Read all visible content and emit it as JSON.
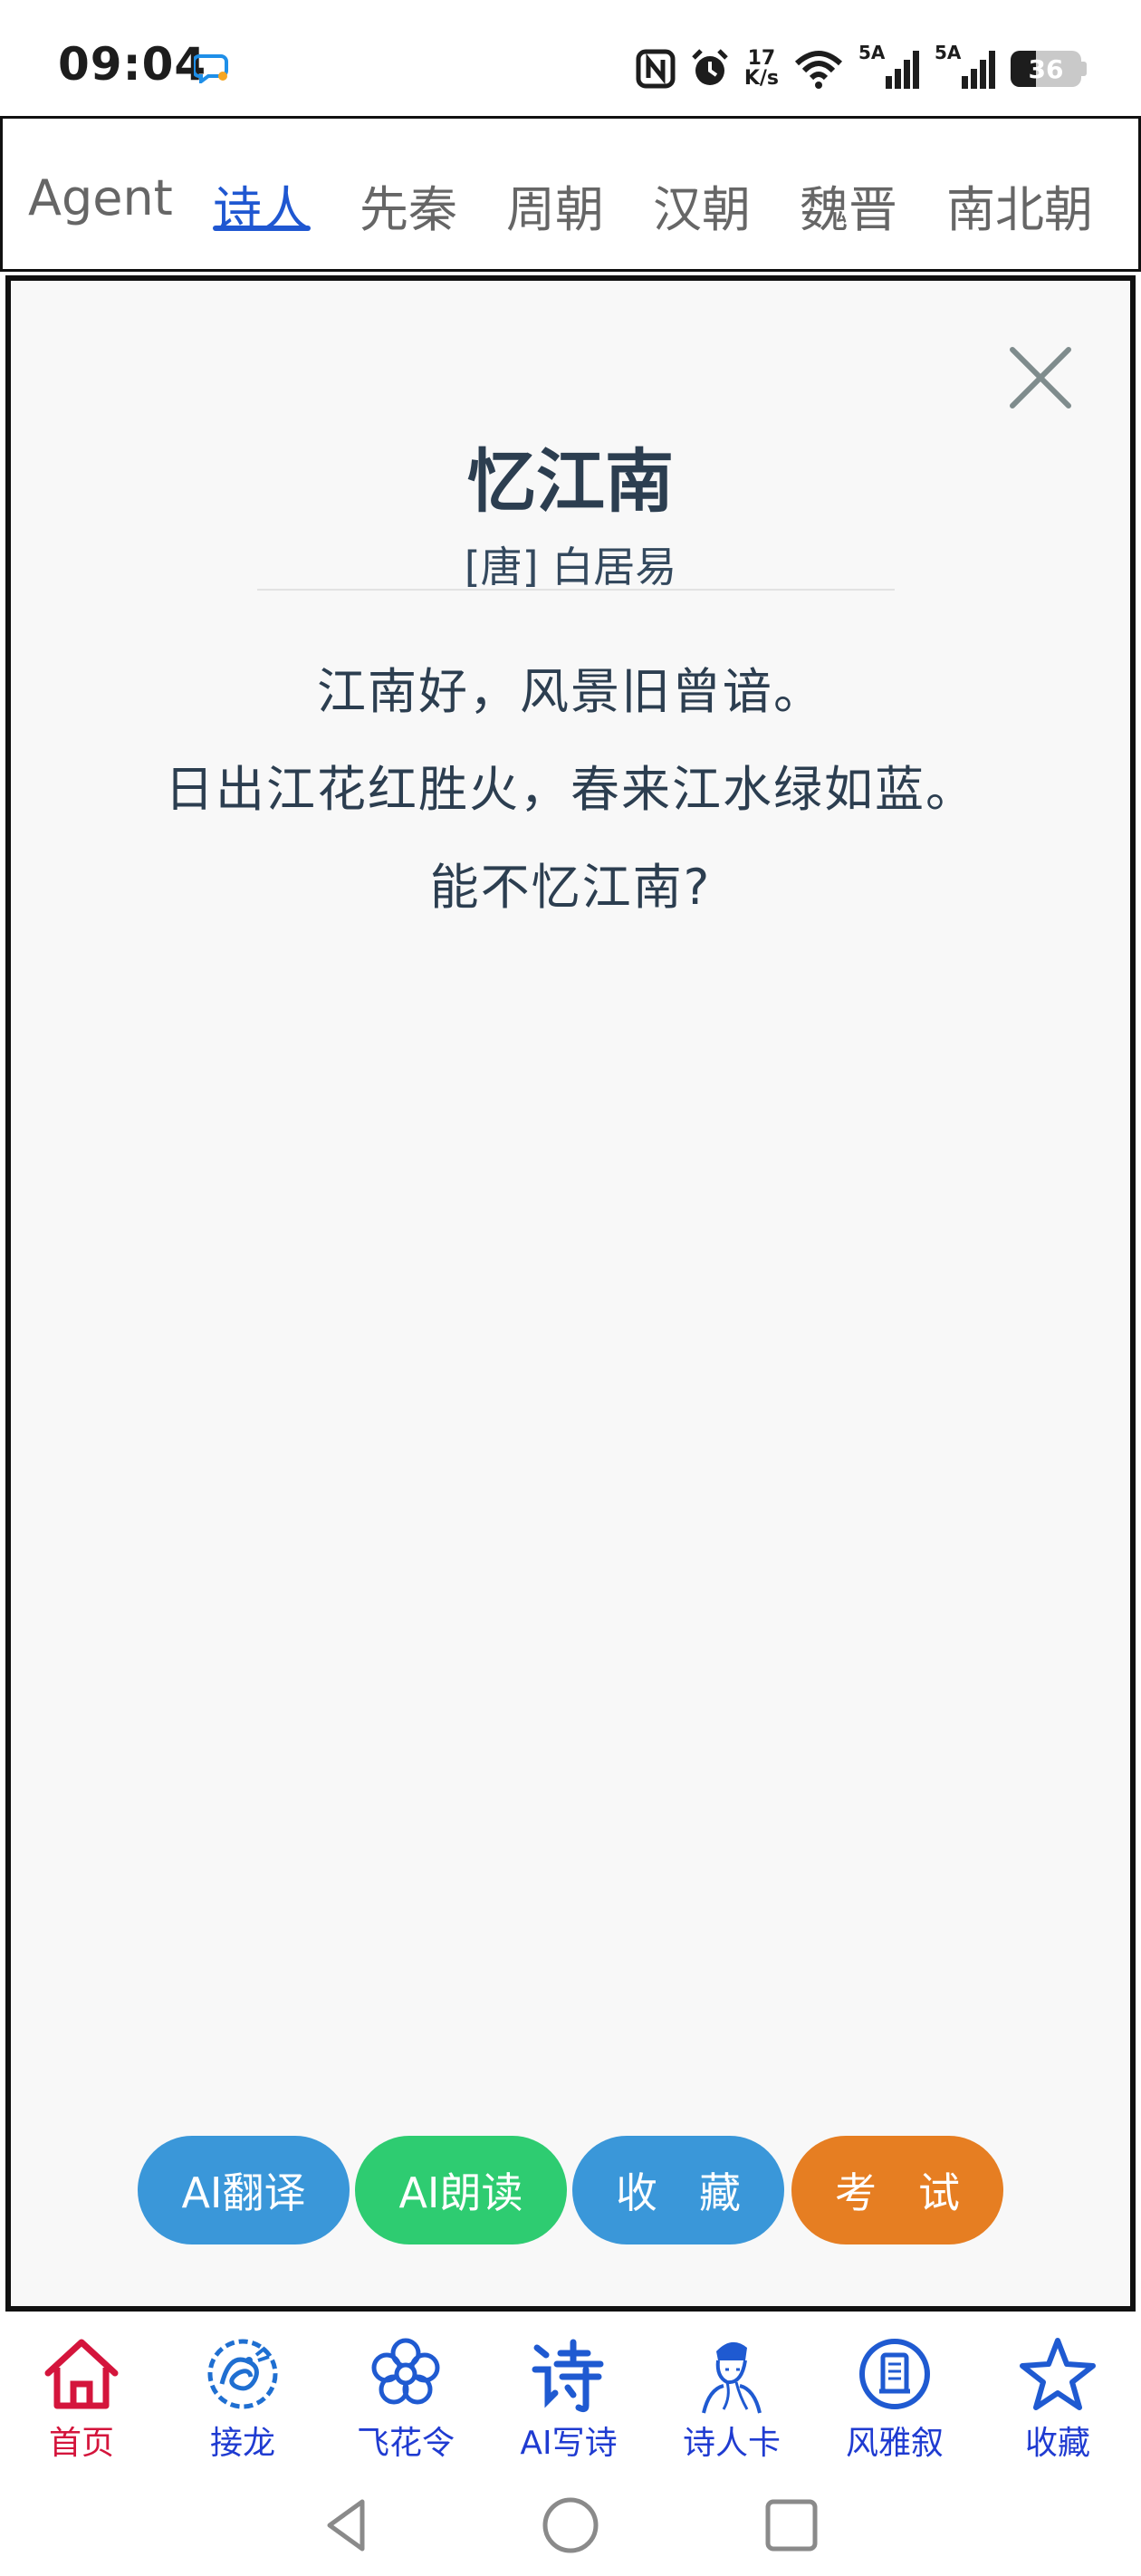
{
  "status_bar": {
    "time": "09:04",
    "net_speed_top": "17",
    "net_speed_bottom": "K/s",
    "sim1_label": "5A",
    "sim2_label": "5A",
    "battery": "36",
    "battery_level": 0.36
  },
  "tabs": [
    {
      "label": "Agent",
      "active": false
    },
    {
      "label": "诗人",
      "active": true
    },
    {
      "label": "先秦",
      "active": false
    },
    {
      "label": "周朝",
      "active": false
    },
    {
      "label": "汉朝",
      "active": false
    },
    {
      "label": "魏晋",
      "active": false
    },
    {
      "label": "南北朝",
      "active": false
    }
  ],
  "poem": {
    "title": "忆江南",
    "author": "[唐] 白居易",
    "lines": [
      "江南好，风景旧曾谙。",
      "日出江花红胜火，春来江水绿如蓝。",
      "能不忆江南?"
    ]
  },
  "actions": [
    {
      "label": "AI翻译",
      "color": "#3a97d9"
    },
    {
      "label": "AI朗读",
      "color": "#2ecc71"
    },
    {
      "label": "收　藏",
      "color": "#3a97d9"
    },
    {
      "label": "考　试",
      "color": "#e67e22"
    }
  ],
  "bottom_nav": [
    {
      "label": "首页",
      "icon": "home-icon",
      "active": true
    },
    {
      "label": "接龙",
      "icon": "dragon-icon",
      "active": false
    },
    {
      "label": "飞花令",
      "icon": "flower-icon",
      "active": false
    },
    {
      "label": "AI写诗",
      "icon": "poem-character-icon",
      "active": false
    },
    {
      "label": "诗人卡",
      "icon": "poet-portrait-icon",
      "active": false
    },
    {
      "label": "风雅叙",
      "icon": "book-circle-icon",
      "active": false
    },
    {
      "label": "收藏",
      "icon": "star-icon",
      "active": false
    }
  ],
  "colors": {
    "accent_blue": "#1f57d1",
    "nav_blue": "#1f3bd1",
    "nav_active_red": "#d4153c",
    "title_text": "#2c3e50"
  }
}
